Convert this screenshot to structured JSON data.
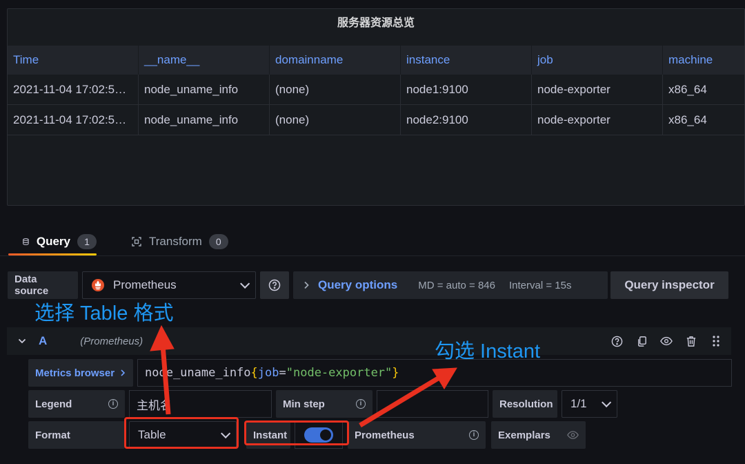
{
  "panel": {
    "title": "服务器资源总览",
    "columns": [
      "Time",
      "__name__",
      "domainname",
      "instance",
      "job",
      "machine"
    ],
    "rows": [
      [
        "2021-11-04 17:02:5…",
        "node_uname_info",
        "(none)",
        "node1:9100",
        "node-exporter",
        "x86_64"
      ],
      [
        "2021-11-04 17:02:5…",
        "node_uname_info",
        "(none)",
        "node2:9100",
        "node-exporter",
        "x86_64"
      ]
    ]
  },
  "tabs": [
    {
      "label": "Query",
      "count": "1",
      "icon": "database-icon",
      "active": true
    },
    {
      "label": "Transform",
      "count": "0",
      "icon": "transform-icon",
      "active": false
    }
  ],
  "toolbar": {
    "data_source_label": "Data source",
    "data_source_value": "Prometheus",
    "query_options_label": "Query options",
    "md": "MD = auto = 846",
    "interval": "Interval = 15s",
    "inspector_label": "Query inspector"
  },
  "query_row": {
    "letter": "A",
    "datasource": "(Prometheus)",
    "metrics_browser": "Metrics browser",
    "expr": {
      "name": "node_uname_info",
      "open": "{",
      "key": "job",
      "eq": "=",
      "value": "\"node-exporter\"",
      "close": "}"
    },
    "legend_label": "Legend",
    "legend_value": "主机名",
    "min_step_label": "Min step",
    "min_step_value": "",
    "resolution_label": "Resolution",
    "resolution_value": "1/1",
    "format_label": "Format",
    "format_value": "Table",
    "instant_label": "Instant",
    "instant_on": true,
    "prometheus_label": "Prometheus",
    "exemplars_label": "Exemplars"
  },
  "annotations": {
    "table_format": "选择 Table 格式",
    "instant": "勾选 Instant"
  },
  "colors": {
    "accent_blue": "#6e9fff",
    "annotation_blue": "#1f97f2",
    "annotation_red": "#e8301f",
    "string_green": "#73bf69",
    "brace_yellow": "#fbca0a"
  }
}
